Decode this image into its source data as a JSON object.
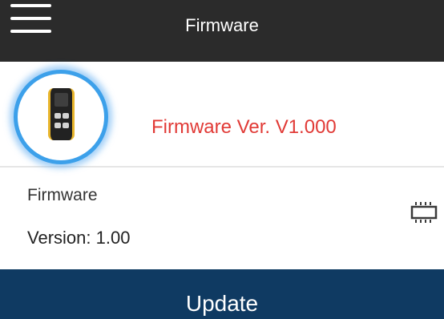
{
  "header": {
    "title": "Firmware",
    "menu_icon": "hamburger-menu-icon",
    "background": "#2b2b2b"
  },
  "device": {
    "image_icon": "gas-detector-device-icon",
    "firmware_version_text": "Firmware Ver. V1.000",
    "firmware_version_color": "#e13a36",
    "ring_color": "#3ca0ea"
  },
  "firmware_info": {
    "title": "Firmware",
    "version_text": "Version: 1.00",
    "chip_icon": "chip-icon"
  },
  "actions": {
    "update_label": "Update",
    "update_color": "#0f3a62"
  }
}
